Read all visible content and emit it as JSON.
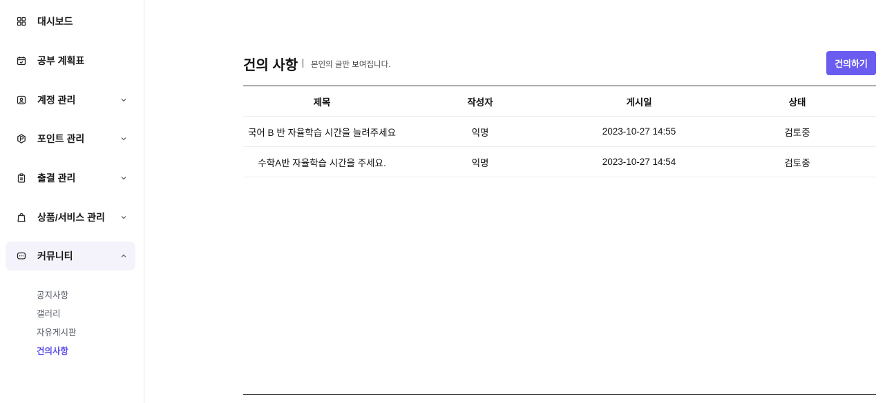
{
  "sidebar": {
    "items": [
      {
        "label": "대시보드",
        "icon": "grid-icon",
        "has_chevron": false
      },
      {
        "label": "공부 계획표",
        "icon": "calendar-icon",
        "has_chevron": false
      },
      {
        "label": "계정 관리",
        "icon": "user-card-icon",
        "has_chevron": true
      },
      {
        "label": "포인트 관리",
        "icon": "point-coin-icon",
        "has_chevron": true
      },
      {
        "label": "출결 관리",
        "icon": "clipboard-icon",
        "has_chevron": true
      },
      {
        "label": "상품/서비스 관리",
        "icon": "shopping-bag-icon",
        "has_chevron": true
      },
      {
        "label": "커뮤니티",
        "icon": "chat-bubble-icon",
        "has_chevron": true,
        "expanded": true,
        "active": true
      }
    ],
    "community_sub": [
      {
        "label": "공지사항",
        "current": false
      },
      {
        "label": "갤러리",
        "current": false
      },
      {
        "label": "자유게시판",
        "current": false
      },
      {
        "label": "건의사항",
        "current": true
      }
    ]
  },
  "main": {
    "title": "건의 사항",
    "subtitle": "본인의 글만 보여집니다.",
    "action_label": "건의하기",
    "table": {
      "headers": [
        "제목",
        "작성자",
        "게시일",
        "상태"
      ],
      "rows": [
        [
          "국어 B 반 자율학습 시간을 늘려주세요",
          "익명",
          "2023-10-27 14:55",
          "검토중"
        ],
        [
          "수학A반 자율학습 시간을 주세요.",
          "익명",
          "2023-10-27 14:54",
          "검토중"
        ]
      ]
    }
  },
  "colors": {
    "accent": "#6b5cf0",
    "active_sub": "#5b4fe8",
    "active_bg": "#f4f3fb"
  }
}
